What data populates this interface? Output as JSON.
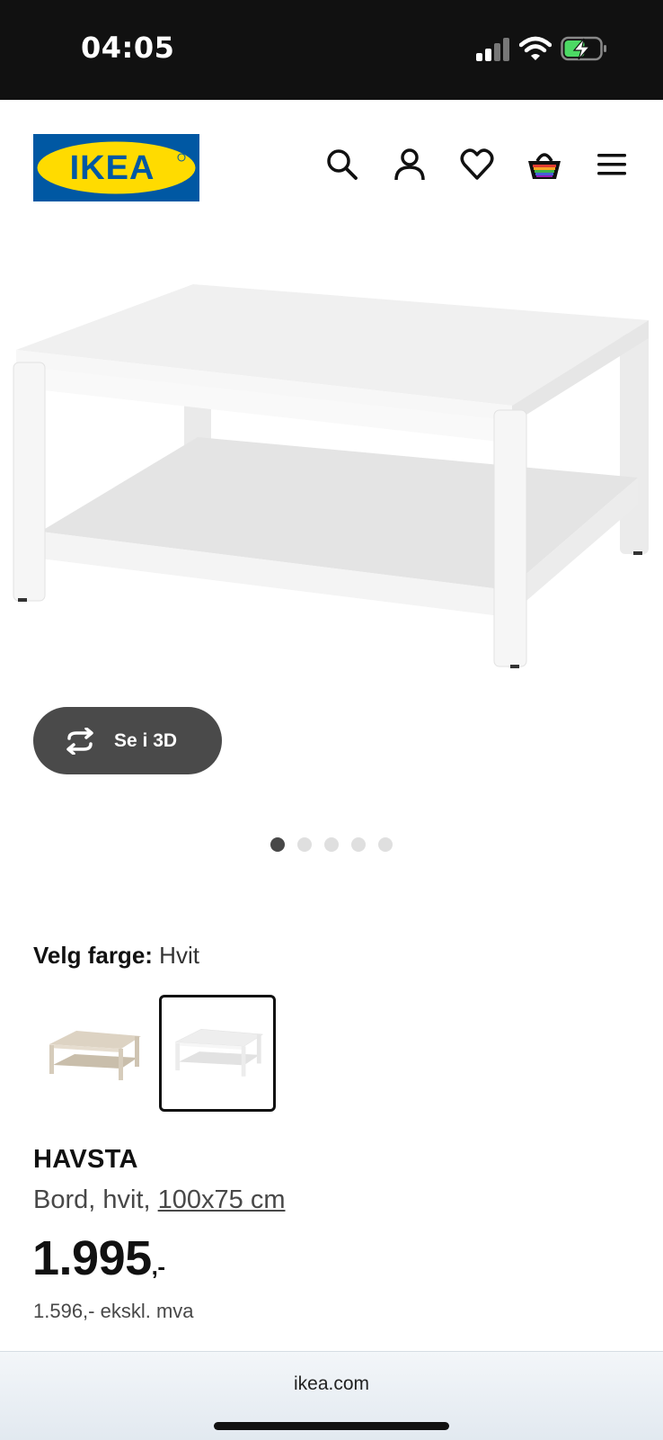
{
  "status_bar": {
    "time": "04:05",
    "icons": [
      "cellular-signal-icon",
      "wifi-icon",
      "battery-charging-icon"
    ]
  },
  "header": {
    "logo_text": "IKEA",
    "icons": [
      "search-icon",
      "account-icon",
      "heart-icon",
      "basket-icon",
      "menu-icon"
    ]
  },
  "gallery": {
    "view_3d_label": "Se i 3D",
    "image_count": 5,
    "active_index": 0
  },
  "color_picker": {
    "label": "Velg farge:",
    "selected": "Hvit",
    "swatches": [
      "beige-table-swatch",
      "white-table-swatch"
    ]
  },
  "product": {
    "name": "HAVSTA",
    "description": "Bord, hvit, ",
    "size": "100x75 cm",
    "price_main": "1.995",
    "price_suffix": ",-",
    "price_ex_vat": "1.596,- ekskl. mva"
  },
  "browser": {
    "url": "ikea.com"
  },
  "colors": {
    "ikea_blue": "#0058A3",
    "ikea_yellow": "#FFDB00",
    "button_dark": "#4a4a4a"
  }
}
